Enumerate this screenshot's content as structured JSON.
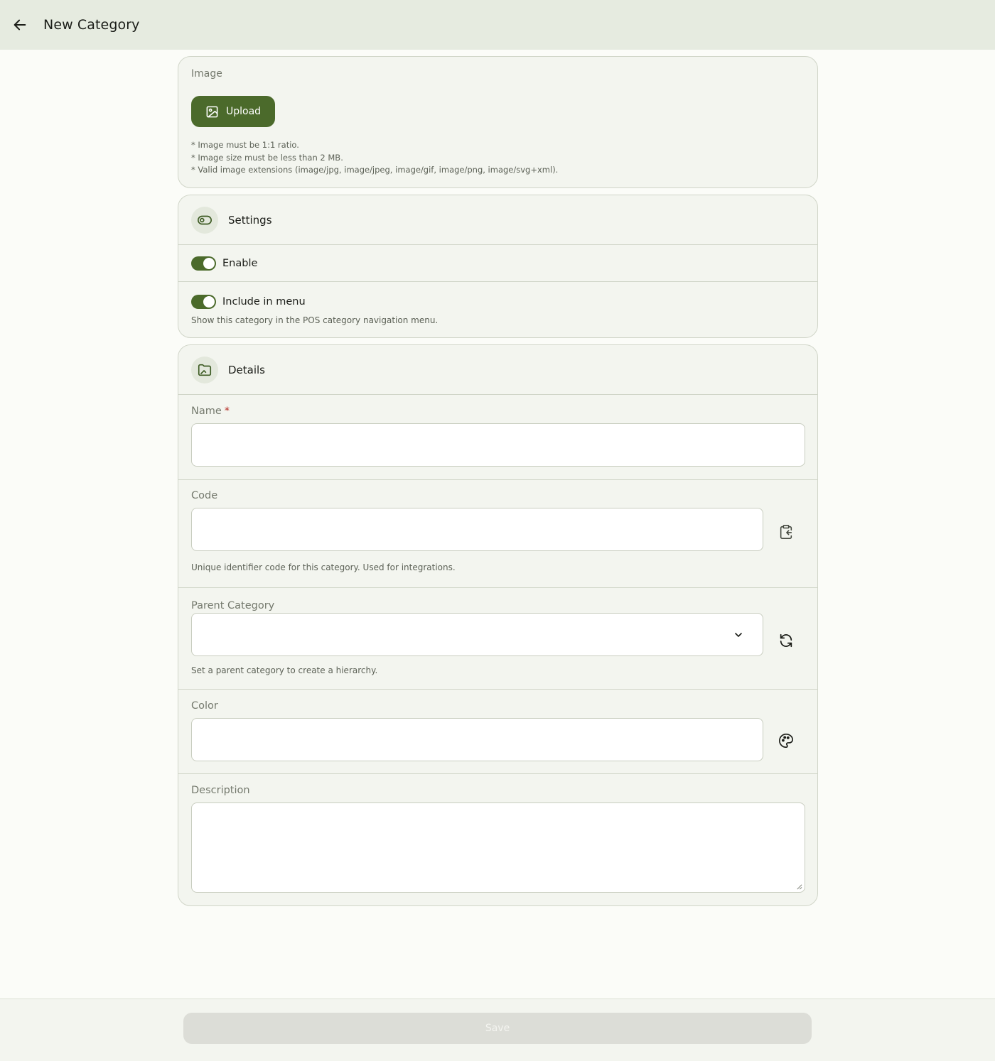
{
  "header": {
    "title": "New Category",
    "back_icon": "arrow-left-icon"
  },
  "image_section": {
    "label": "Image",
    "upload_label": "Upload",
    "upload_icon": "image-icon",
    "notes": [
      "* Image must be 1:1 ratio.",
      "* Image size must be less than 2 MB.",
      "* Valid image extensions (image/jpg, image/jpeg, image/gif, image/png, image/svg+xml)."
    ]
  },
  "settings": {
    "title": "Settings",
    "icon": "toggle-icon",
    "enable": {
      "label": "Enable",
      "on": true
    },
    "include_in_menu": {
      "label": "Include in menu",
      "on": true,
      "hint": "Show this category in the POS category navigation menu."
    }
  },
  "details": {
    "title": "Details",
    "icon": "folder-icon",
    "name": {
      "label": "Name",
      "required_mark": "*",
      "value": ""
    },
    "code": {
      "label": "Code",
      "value": "",
      "hint": "Unique identifier code for this category. Used for integrations.",
      "action_icon": "clipboard-paste-icon"
    },
    "parent": {
      "label": "Parent Category",
      "value": "",
      "hint": "Set a parent category to create a hierarchy.",
      "action_icon": "refresh-icon"
    },
    "color": {
      "label": "Color",
      "value": "",
      "action_icon": "palette-icon"
    },
    "description": {
      "label": "Description",
      "value": ""
    }
  },
  "footer": {
    "save_label": "Save"
  },
  "colors": {
    "primary": "#4b6a2b",
    "topbar": "#e6ebe0",
    "card": "#f3f5ef",
    "required": "#b3261e"
  }
}
